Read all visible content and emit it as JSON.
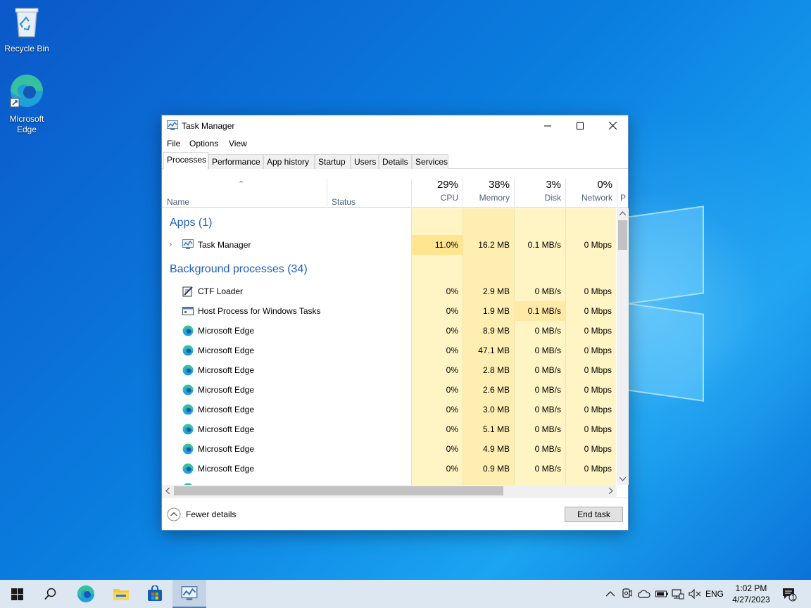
{
  "desktop": {
    "icons": [
      {
        "label": "Recycle Bin"
      },
      {
        "label": "Microsoft Edge"
      }
    ]
  },
  "window": {
    "title": "Task Manager",
    "menu": [
      "File",
      "Options",
      "View"
    ],
    "tabs": [
      "Processes",
      "Performance",
      "App history",
      "Startup",
      "Users",
      "Details",
      "Services"
    ],
    "active_tab": "Processes"
  },
  "columns": {
    "name": "Name",
    "status": "Status",
    "cpu": {
      "pct": "29%",
      "label": "CPU"
    },
    "memory": {
      "pct": "38%",
      "label": "Memory"
    },
    "disk": {
      "pct": "3%",
      "label": "Disk"
    },
    "network": {
      "pct": "0%",
      "label": "Network"
    },
    "power_cut": "P"
  },
  "groups": {
    "apps": "Apps (1)",
    "background": "Background processes (34)"
  },
  "apps": [
    {
      "name": "Task Manager",
      "cpu": "11.0%",
      "memory": "16.2 MB",
      "disk": "0.1 MB/s",
      "network": "0 Mbps",
      "icon": "task-manager-icon"
    }
  ],
  "background": [
    {
      "name": "CTF Loader",
      "cpu": "0%",
      "memory": "2.9 MB",
      "disk": "0 MB/s",
      "network": "0 Mbps",
      "icon": "ctf-loader-icon"
    },
    {
      "name": "Host Process for Windows Tasks",
      "cpu": "0%",
      "memory": "1.9 MB",
      "disk": "0.1 MB/s",
      "network": "0 Mbps",
      "icon": "host-process-icon"
    },
    {
      "name": "Microsoft Edge",
      "cpu": "0%",
      "memory": "8.9 MB",
      "disk": "0 MB/s",
      "network": "0 Mbps",
      "icon": "edge-icon"
    },
    {
      "name": "Microsoft Edge",
      "cpu": "0%",
      "memory": "47.1 MB",
      "disk": "0 MB/s",
      "network": "0 Mbps",
      "icon": "edge-icon"
    },
    {
      "name": "Microsoft Edge",
      "cpu": "0%",
      "memory": "2.8 MB",
      "disk": "0 MB/s",
      "network": "0 Mbps",
      "icon": "edge-icon"
    },
    {
      "name": "Microsoft Edge",
      "cpu": "0%",
      "memory": "2.6 MB",
      "disk": "0 MB/s",
      "network": "0 Mbps",
      "icon": "edge-icon"
    },
    {
      "name": "Microsoft Edge",
      "cpu": "0%",
      "memory": "3.0 MB",
      "disk": "0 MB/s",
      "network": "0 Mbps",
      "icon": "edge-icon"
    },
    {
      "name": "Microsoft Edge",
      "cpu": "0%",
      "memory": "5.1 MB",
      "disk": "0 MB/s",
      "network": "0 Mbps",
      "icon": "edge-icon"
    },
    {
      "name": "Microsoft Edge",
      "cpu": "0%",
      "memory": "4.9 MB",
      "disk": "0 MB/s",
      "network": "0 Mbps",
      "icon": "edge-icon"
    },
    {
      "name": "Microsoft Edge",
      "cpu": "0%",
      "memory": "0.9 MB",
      "disk": "0 MB/s",
      "network": "0 Mbps",
      "icon": "edge-icon"
    }
  ],
  "footer": {
    "fewer_details": "Fewer details",
    "end_task": "End task"
  },
  "taskbar": {
    "language": "ENG",
    "time": "1:02 PM",
    "date": "4/27/2023",
    "notification_count": "1"
  },
  "colors": {
    "heat_light": "#fff4c4",
    "heat_med": "#ffe79e",
    "heat_strong": "#fde8a0",
    "group_blue": "#1f5fbf",
    "header_gray": "#4c607a"
  }
}
